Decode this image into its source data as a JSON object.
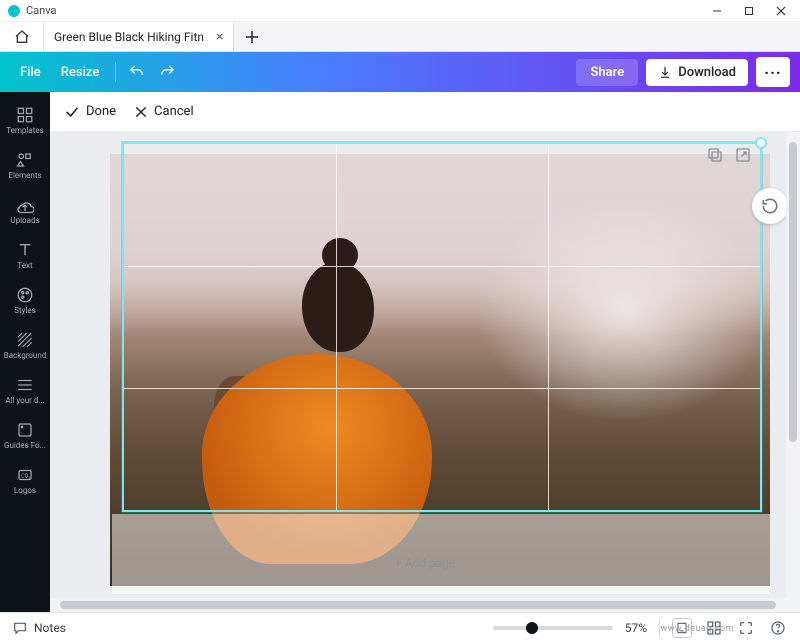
{
  "window": {
    "app_title": "Canva",
    "controls": {
      "minimize": "minimize",
      "maximize": "maximize",
      "close": "close"
    }
  },
  "tabs": {
    "home_label": "Home",
    "open": [
      {
        "title": "Green Blue Black Hiking Fitn"
      }
    ],
    "add_label": "New tab"
  },
  "toolbar": {
    "file_label": "File",
    "resize_label": "Resize",
    "undo_label": "Undo",
    "redo_label": "Redo",
    "share_label": "Share",
    "download_label": "Download",
    "more_label": "More"
  },
  "editbar": {
    "done_label": "Done",
    "cancel_label": "Cancel"
  },
  "sidebar": {
    "items": [
      {
        "key": "templates",
        "label": "Templates"
      },
      {
        "key": "elements",
        "label": "Elements"
      },
      {
        "key": "uploads",
        "label": "Uploads"
      },
      {
        "key": "text",
        "label": "Text"
      },
      {
        "key": "styles",
        "label": "Styles"
      },
      {
        "key": "background",
        "label": "Background"
      },
      {
        "key": "allyourd",
        "label": "All your d..."
      },
      {
        "key": "guidesfo",
        "label": "Guides Fo..."
      },
      {
        "key": "logos",
        "label": "Logos"
      }
    ]
  },
  "canvas": {
    "page_actions": {
      "duplicate": "Duplicate page",
      "export": "Open page"
    },
    "rotate_label": "Rotate",
    "add_page_label": "+ Add page"
  },
  "status": {
    "notes_label": "Notes",
    "zoom_percent": "57%",
    "zoom_value": 57,
    "pages_label": "Pages",
    "grid_label": "Grid view",
    "fullscreen_label": "Present",
    "help_label": "Help"
  },
  "watermark": "www.deuaq.com"
}
